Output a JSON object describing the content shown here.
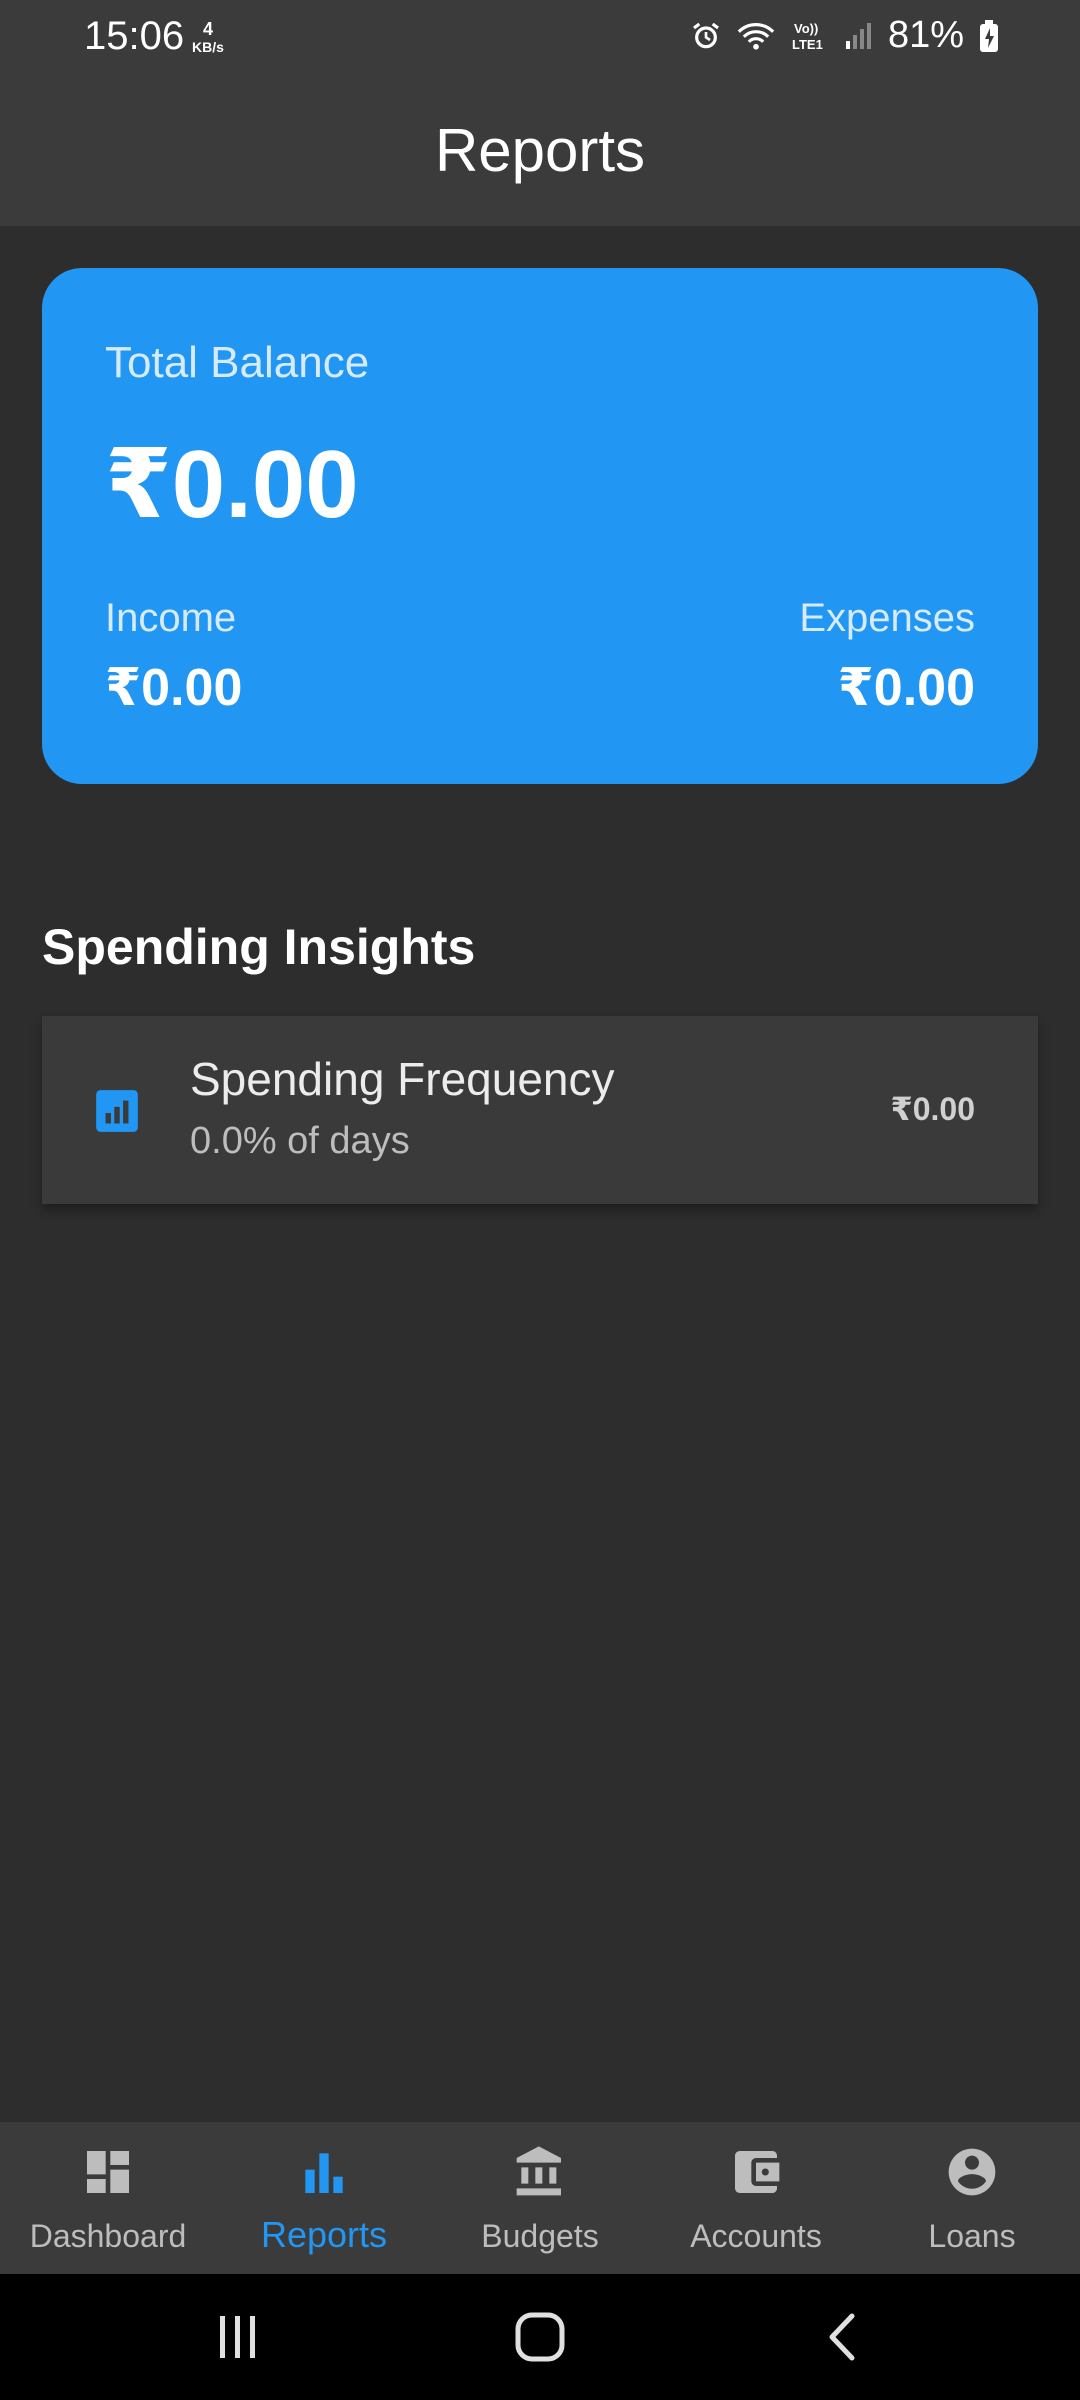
{
  "status_bar": {
    "time": "15:06",
    "speed_value": "4",
    "speed_unit": "KB/s",
    "battery": "81%"
  },
  "app_bar": {
    "title": "Reports"
  },
  "balance_card": {
    "total_label": "Total Balance",
    "total_value": "₹0.00",
    "income_label": "Income",
    "income_value": "₹0.00",
    "expenses_label": "Expenses",
    "expenses_value": "₹0.00",
    "color": "#2196f3"
  },
  "insights": {
    "section_title": "Spending Insights",
    "items": [
      {
        "icon": "bar-chart-icon",
        "title": "Spending Frequency",
        "subtitle": "0.0% of days",
        "value": "₹0.00"
      }
    ]
  },
  "bottom_nav": {
    "active_index": 1,
    "accent": "#2196f3",
    "items": [
      {
        "label": "Dashboard",
        "icon": "dashboard-icon"
      },
      {
        "label": "Reports",
        "icon": "bar-chart-icon"
      },
      {
        "label": "Budgets",
        "icon": "bank-icon"
      },
      {
        "label": "Accounts",
        "icon": "wallet-icon"
      },
      {
        "label": "Loans",
        "icon": "account-circle-icon"
      }
    ]
  }
}
